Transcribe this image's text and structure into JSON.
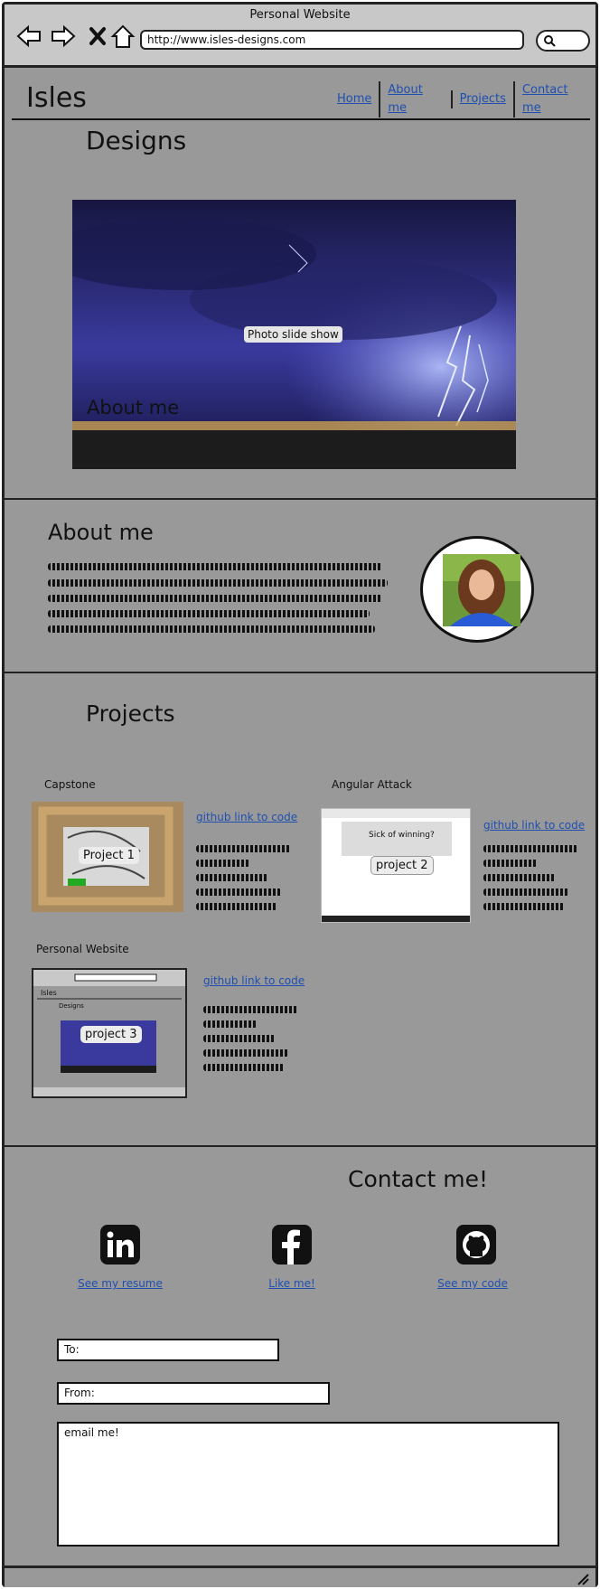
{
  "window": {
    "title": "Personal Website",
    "url": "http://www.isles-designs.com"
  },
  "header": {
    "logo": "Isles",
    "logo_sub": "Designs",
    "nav": [
      "Home",
      "About me",
      "Projects",
      "Contact me"
    ]
  },
  "hero": {
    "badge": "Photo slide show",
    "caption": "About me"
  },
  "about": {
    "title": "About me"
  },
  "projects": {
    "title": "Projects",
    "items": [
      {
        "title": "Capstone",
        "badge": "Project 1",
        "link": "github link to code"
      },
      {
        "title": "Angular Attack",
        "badge": "project 2",
        "link": "github link to code"
      },
      {
        "title": "Personal Website",
        "badge": "project 3",
        "link": "github link to code"
      }
    ],
    "angular_thumb_text": "Sick of winning?"
  },
  "contact": {
    "title": "Contact me!",
    "social": [
      {
        "icon": "linkedin-icon",
        "label": "See my resume"
      },
      {
        "icon": "facebook-icon",
        "label": "Like me!"
      },
      {
        "icon": "github-icon",
        "label": "See my code"
      }
    ],
    "to_placeholder": "To:",
    "from_placeholder": "From:",
    "message_placeholder": "email me!"
  },
  "colors": {
    "page_bg": "#999999",
    "link": "#1f4fb0",
    "chrome": "#c8c8c8"
  }
}
